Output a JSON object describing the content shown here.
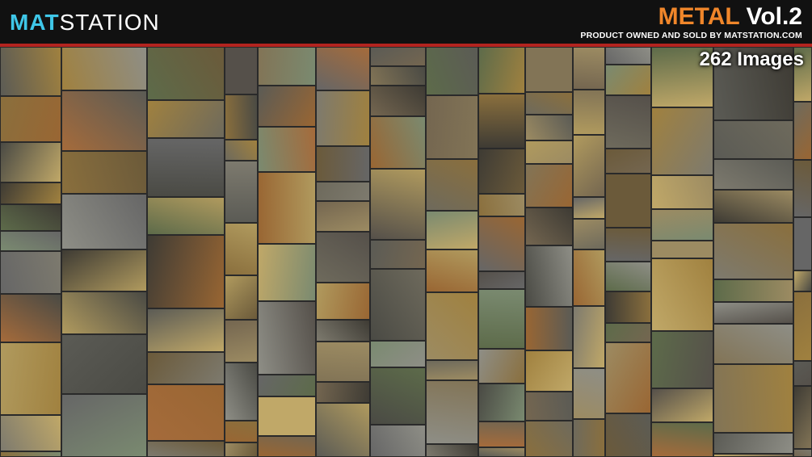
{
  "brand": {
    "logo_part1": "MAT",
    "logo_part2": "STATION"
  },
  "product": {
    "title_word": "METAL",
    "title_volume": "Vol.2",
    "tagline": "PRODUCT OWNED AND SOLD BY MATSTATION.COM",
    "image_count": "262 Images"
  },
  "colors": {
    "logo_accent": "#3fc7e8",
    "title_accent": "#f0862a",
    "rule": "#b3241f",
    "header_bg": "#111111"
  }
}
